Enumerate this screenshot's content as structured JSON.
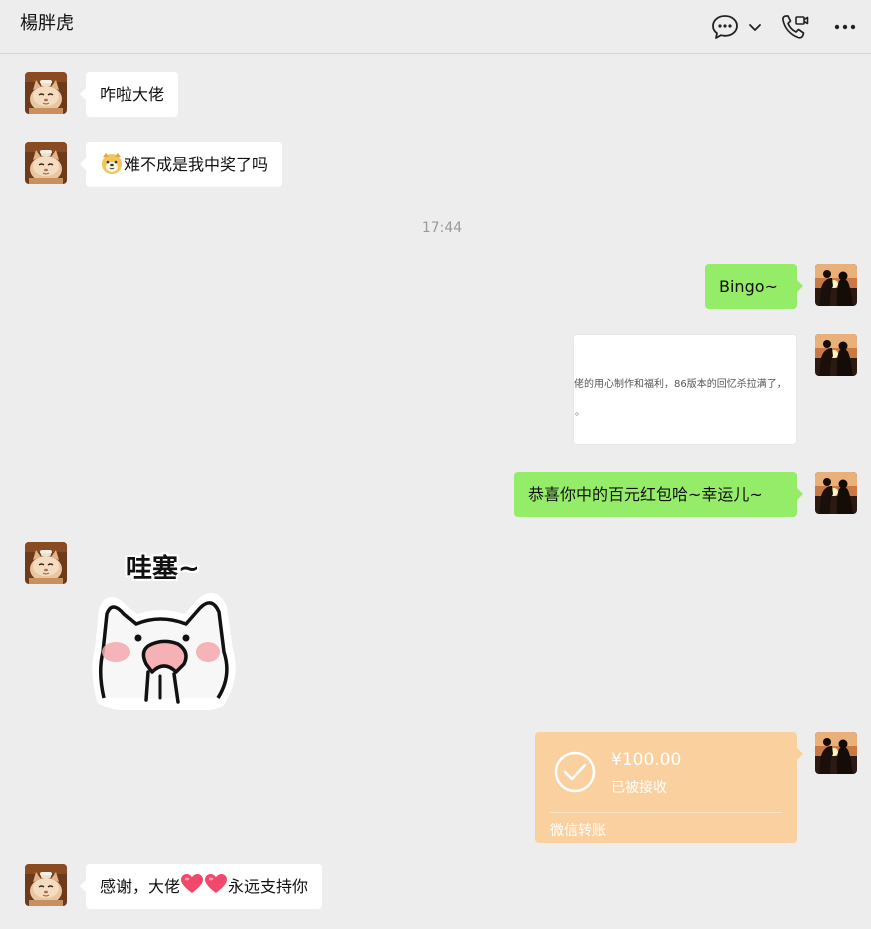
{
  "header": {
    "title": "楊胖虎",
    "chat_icon": "chat-bubble-icon",
    "dropdown_icon": "chevron-down-icon",
    "call_icon": "video-call-icon",
    "more_icon": "more-icon"
  },
  "messages": [
    {
      "side": "in",
      "text": "咋啦大佬"
    },
    {
      "side": "in",
      "emoji": "dog-face-emoji",
      "text": "难不成是我中奖了吗"
    },
    {
      "type": "time",
      "text": "17:44"
    },
    {
      "side": "out",
      "text": "Bingo~"
    },
    {
      "side": "out",
      "type": "link-card",
      "text": "佬的用心制作和福利，86版本的回忆杀拉满了，",
      "text2": "。"
    },
    {
      "side": "out",
      "text": "恭喜你中的百元红包哈~幸运儿~"
    },
    {
      "side": "in",
      "type": "sticker",
      "text": "哇塞~"
    },
    {
      "side": "out",
      "type": "transfer",
      "amount": "¥100.00",
      "status": "已被接收",
      "label": "微信转账"
    },
    {
      "side": "in",
      "text_before": "感谢，大佬",
      "emoji": "heart-emoji",
      "text_after": "永远支持你"
    }
  ],
  "colors": {
    "background": "#ededed",
    "incoming_bubble": "#ffffff",
    "outgoing_bubble": "#95ec69",
    "transfer_card": "#fbd09f"
  }
}
